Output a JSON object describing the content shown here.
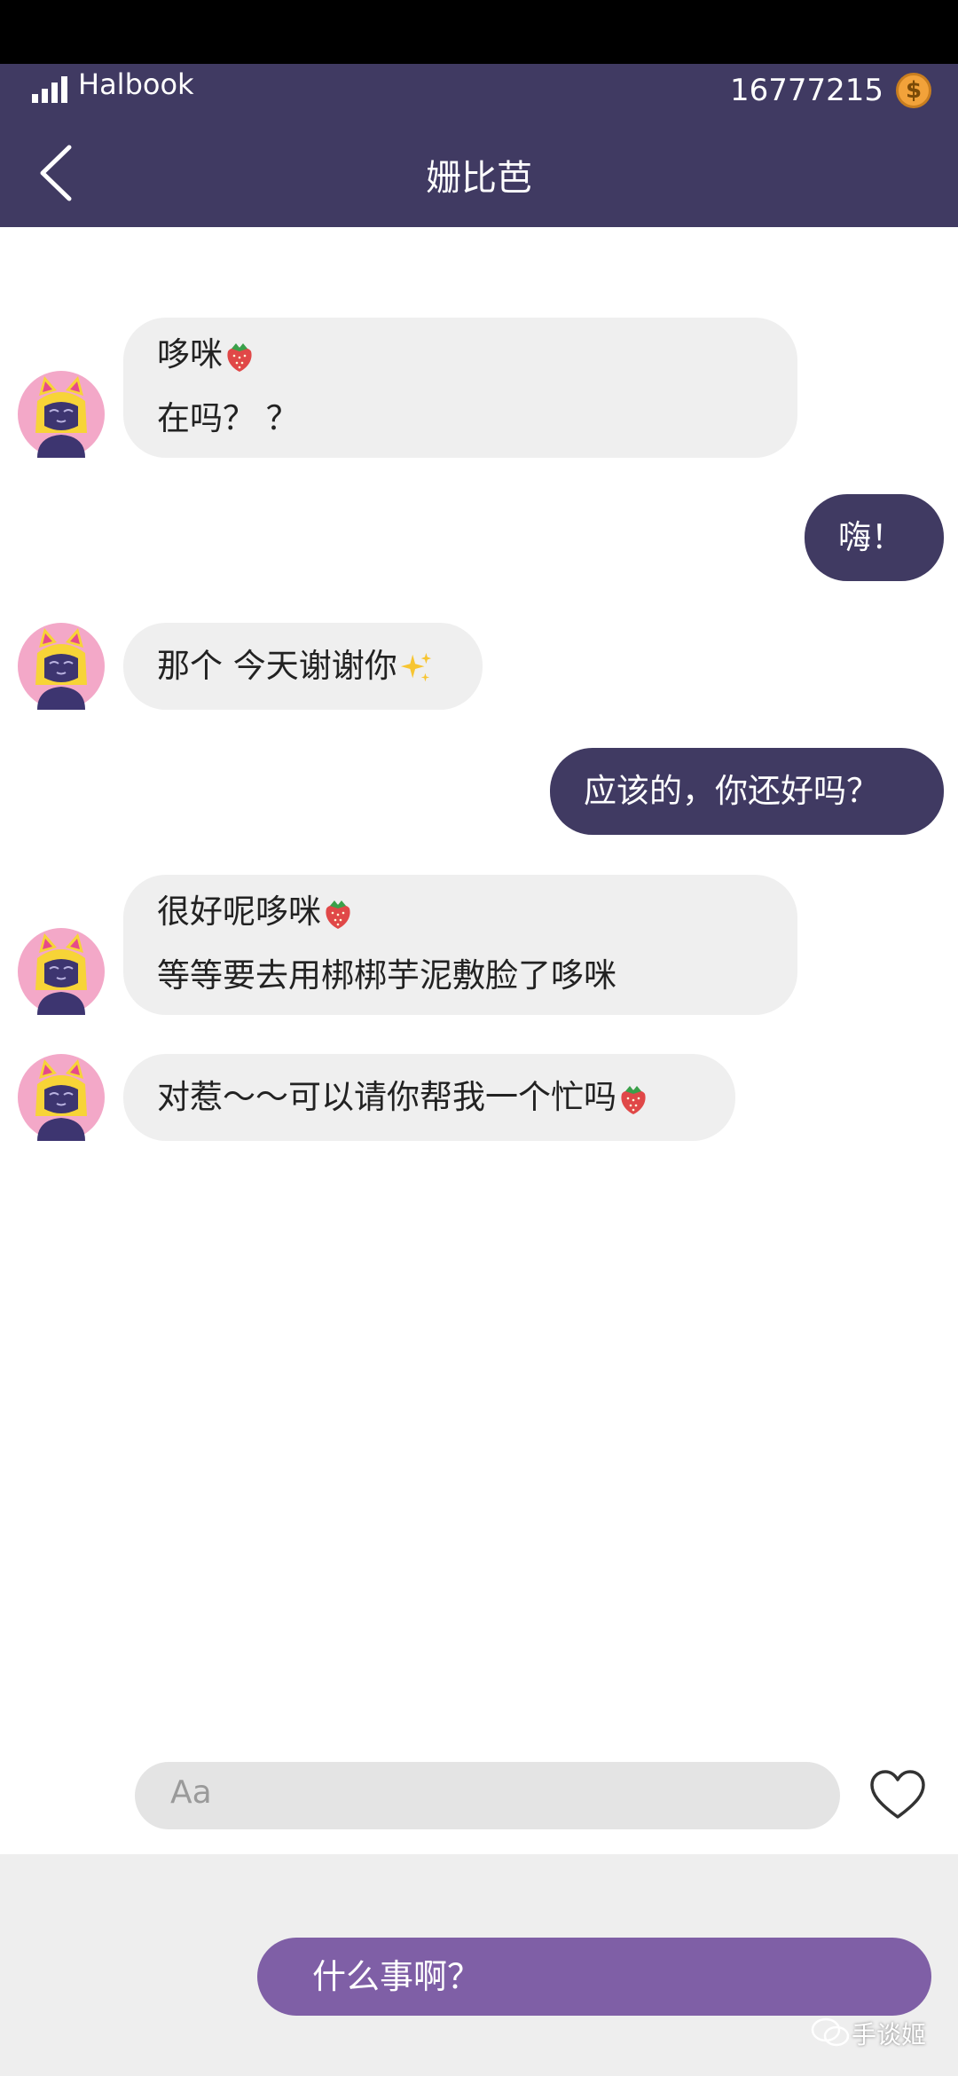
{
  "status_bar": {
    "carrier": "Halbook",
    "coins": "16777215",
    "coin_symbol": "$"
  },
  "header": {
    "title": "姗比芭"
  },
  "messages": [
    {
      "from": "other",
      "lines": [
        "哆咪",
        "在吗？ ？"
      ],
      "emoji": [
        "strawberry"
      ]
    },
    {
      "from": "me",
      "lines": [
        "嗨！"
      ]
    },
    {
      "from": "other",
      "lines": [
        "那个 今天谢谢你"
      ],
      "emoji": [
        "sparkles"
      ]
    },
    {
      "from": "me",
      "lines": [
        "应该的，你还好吗？"
      ]
    },
    {
      "from": "other",
      "lines": [
        "很好呢哆咪",
        "等等要去用梆梆芋泥敷脸了哆咪"
      ],
      "emoji": [
        "strawberry"
      ]
    },
    {
      "from": "other",
      "lines": [
        "对惹～～可以请你帮我一个忙吗"
      ],
      "emoji": [
        "strawberry"
      ]
    }
  ],
  "input": {
    "placeholder": "Aa"
  },
  "quick_reply": {
    "label": "什么事啊？"
  },
  "watermark": {
    "text": "手谈姬"
  },
  "colors": {
    "header": "#403a62",
    "outgoing_bubble": "#403a62",
    "incoming_bubble": "#efefef",
    "reply_button": "#7f5fa6"
  }
}
